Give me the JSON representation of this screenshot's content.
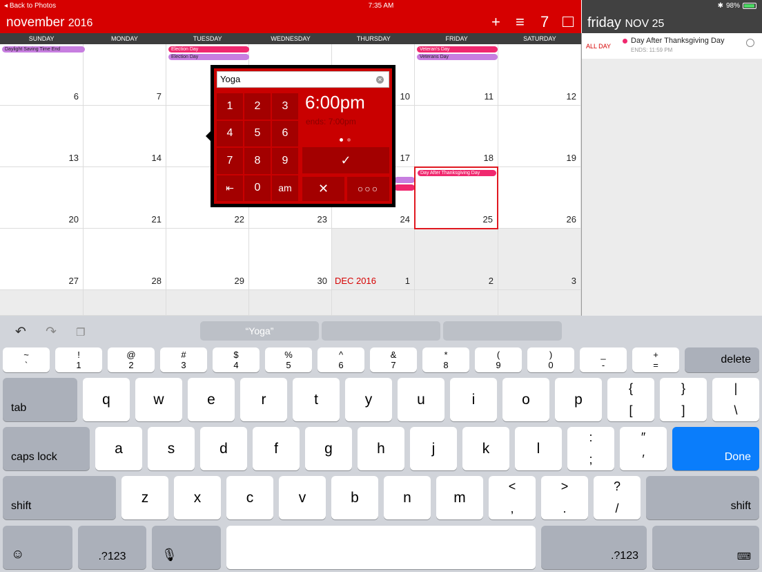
{
  "status": {
    "back": "Back to Photos",
    "time": "7:35 AM",
    "battery": "98%"
  },
  "header": {
    "month": "november",
    "year": "2016",
    "icons": [
      "plus-icon",
      "list-icon",
      "week-number-icon",
      "month-view-icon"
    ],
    "week_number_label": "7"
  },
  "weekdays": [
    "SUNDAY",
    "MONDAY",
    "TUESDAY",
    "WEDNESDAY",
    "THURSDAY",
    "FRIDAY",
    "SATURDAY"
  ],
  "weeks": [
    [
      "6",
      "7",
      "8",
      "9",
      "10",
      "11",
      "12"
    ],
    [
      "13",
      "14",
      "15",
      "16",
      "17",
      "18",
      "19"
    ],
    [
      "20",
      "21",
      "22",
      "23",
      "24",
      "25",
      "26"
    ],
    [
      "27",
      "28",
      "29",
      "30",
      "1",
      "2",
      "3"
    ]
  ],
  "next_month_label": "DEC 2016",
  "events": {
    "dst": "Daylight Saving Time End",
    "election_1": "Election Day",
    "election_2": "Election Day",
    "veterans_1": "Veteran's Day",
    "veterans_2": "Veterans Day",
    "after_thanksgiving": "Day After Thanksgiving Day"
  },
  "day_panel": {
    "day": "friday",
    "date": "NOV 25",
    "allday_label": "ALL DAY",
    "event_title": "Day After Thanksgiving Day",
    "event_ends": "ENDS: 11:59 PM"
  },
  "quick_add": {
    "title_value": "Yoga",
    "keypad": [
      "1",
      "2",
      "3",
      "4",
      "5",
      "6",
      "7",
      "8",
      "9",
      "⇤",
      "0",
      "am"
    ],
    "time": "6:00pm",
    "ends": "ends: 7:00pm",
    "confirm": "✓",
    "cancel": "✕",
    "more": "○○○"
  },
  "keyboard": {
    "suggestions": [
      "“Yoga”",
      "",
      ""
    ],
    "number_row": [
      [
        "~",
        "`"
      ],
      [
        "!",
        "1"
      ],
      [
        "@",
        "2"
      ],
      [
        "#",
        "3"
      ],
      [
        "$",
        "4"
      ],
      [
        "%",
        "5"
      ],
      [
        "^",
        "6"
      ],
      [
        "&",
        "7"
      ],
      [
        "*",
        "8"
      ],
      [
        "(",
        "9"
      ],
      [
        ")",
        "0"
      ],
      [
        "_",
        "-"
      ],
      [
        "+",
        "="
      ]
    ],
    "row_q": [
      "q",
      "w",
      "e",
      "r",
      "t",
      "y",
      "u",
      "i",
      "o",
      "p"
    ],
    "row_q_symbols": [
      [
        "{",
        "["
      ],
      [
        "}",
        "]"
      ],
      [
        "|",
        "\\"
      ]
    ],
    "row_a": [
      "a",
      "s",
      "d",
      "f",
      "g",
      "h",
      "j",
      "k",
      "l"
    ],
    "row_a_symbols": [
      [
        ":",
        ";"
      ],
      [
        "″",
        "′"
      ]
    ],
    "row_z": [
      "z",
      "x",
      "c",
      "v",
      "b",
      "n",
      "m"
    ],
    "row_z_symbols": [
      [
        "<",
        ","
      ],
      [
        ">",
        "."
      ],
      [
        "?",
        "/"
      ]
    ],
    "labels": {
      "delete": "delete",
      "tab": "tab",
      "caps": "caps lock",
      "done": "Done",
      "shift": "shift",
      "numbers": ".?123"
    }
  }
}
